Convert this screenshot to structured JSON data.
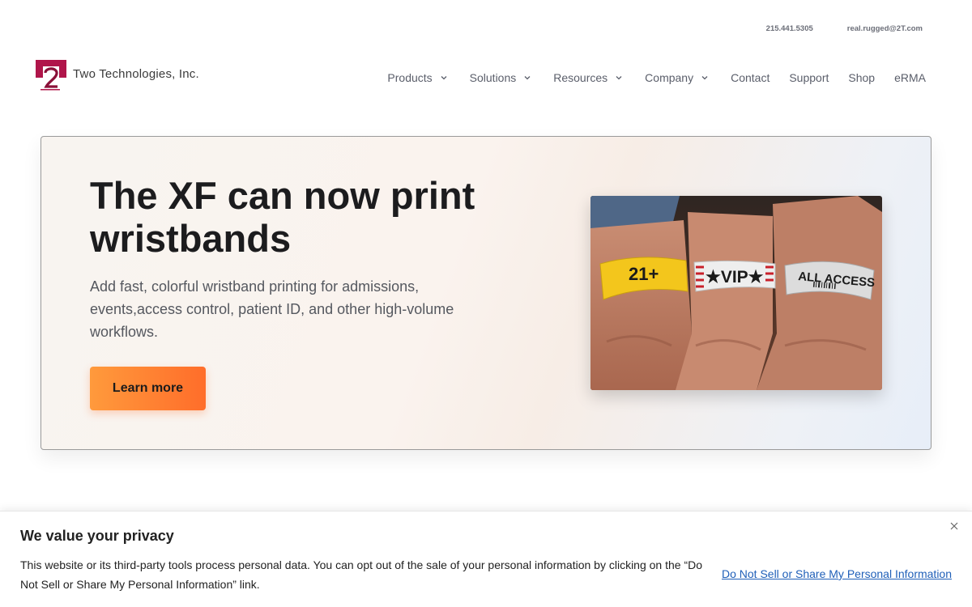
{
  "topbar": {
    "phone": "215.441.5305",
    "email": "real.rugged@2T.com"
  },
  "header": {
    "logo_text": "Two Technologies, Inc.",
    "logo_icon": "2t-logo-mark",
    "nav": [
      {
        "label": "Products",
        "dropdown": true
      },
      {
        "label": "Solutions",
        "dropdown": true
      },
      {
        "label": "Resources",
        "dropdown": true
      },
      {
        "label": "Company",
        "dropdown": true
      },
      {
        "label": "Contact",
        "dropdown": false
      },
      {
        "label": "Support",
        "dropdown": false
      },
      {
        "label": "Shop",
        "dropdown": false
      },
      {
        "label": "eRMA",
        "dropdown": false
      }
    ]
  },
  "hero": {
    "title": "The XF can now print wristbands",
    "description": "Add fast, colorful wristband printing for admissions, events,access control, patient ID, and other high-volume workflows.",
    "cta_label": "Learn more",
    "image": {
      "band_1": "21+",
      "band_2": "★VIP★",
      "band_3": "ALL ACCESS"
    }
  },
  "privacy": {
    "title": "We value your privacy",
    "text": "This website or its third-party tools process personal data. You can opt out of the sale of your personal information by clicking on the “Do Not Sell or Share My Personal Information” link.",
    "link_label": "Do Not Sell or Share My Personal Information"
  },
  "colors": {
    "accent_orange_start": "#ff9a3c",
    "accent_orange_end": "#ff6d2a",
    "brand_red": "#b0154a",
    "link_blue": "#1f5fb8"
  }
}
